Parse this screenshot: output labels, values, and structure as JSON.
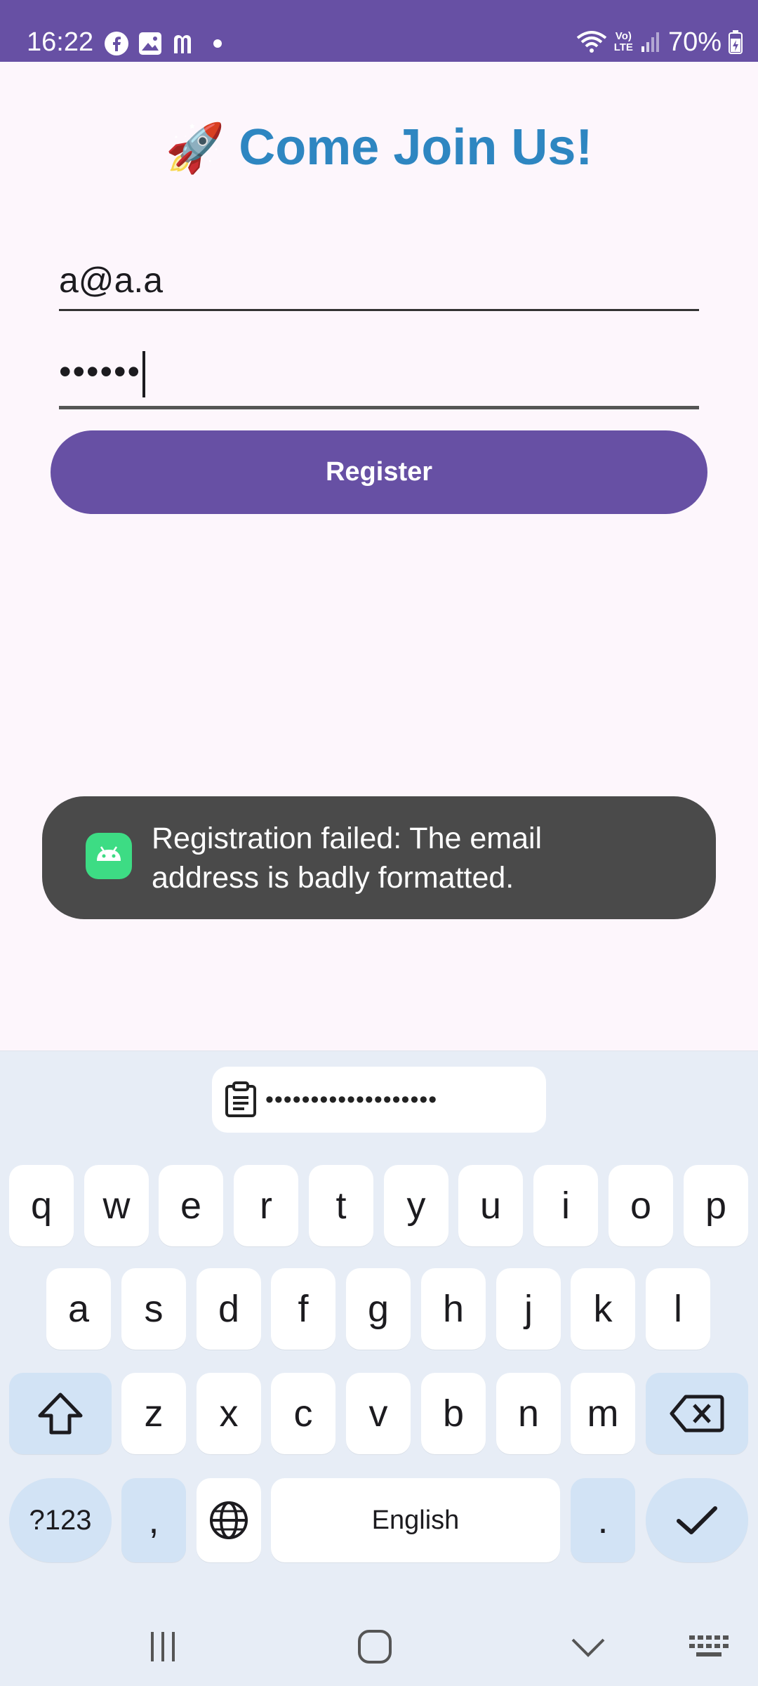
{
  "status_bar": {
    "time": "16:22",
    "battery": "70%",
    "network": "LTE"
  },
  "title": {
    "emoji": "🚀",
    "text": "Come Join Us!"
  },
  "form": {
    "email_value": "a@a.a",
    "password_value": "••••••",
    "register_label": "Register"
  },
  "toast": {
    "message": "Registration failed: The email address is badly formatted."
  },
  "keyboard": {
    "clipboard_preview": "•••••••••••••••••••",
    "row1": [
      "q",
      "w",
      "e",
      "r",
      "t",
      "y",
      "u",
      "i",
      "o",
      "p"
    ],
    "row2": [
      "a",
      "s",
      "d",
      "f",
      "g",
      "h",
      "j",
      "k",
      "l"
    ],
    "row3": [
      "z",
      "x",
      "c",
      "v",
      "b",
      "n",
      "m"
    ],
    "symbols_label": "?123",
    "comma_label": ",",
    "space_label": "English",
    "period_label": "."
  },
  "colors": {
    "primary": "#6750a4",
    "title": "#2e86c1",
    "toast_bg": "#4a4a4a",
    "keyboard_bg": "#e7edf6"
  }
}
